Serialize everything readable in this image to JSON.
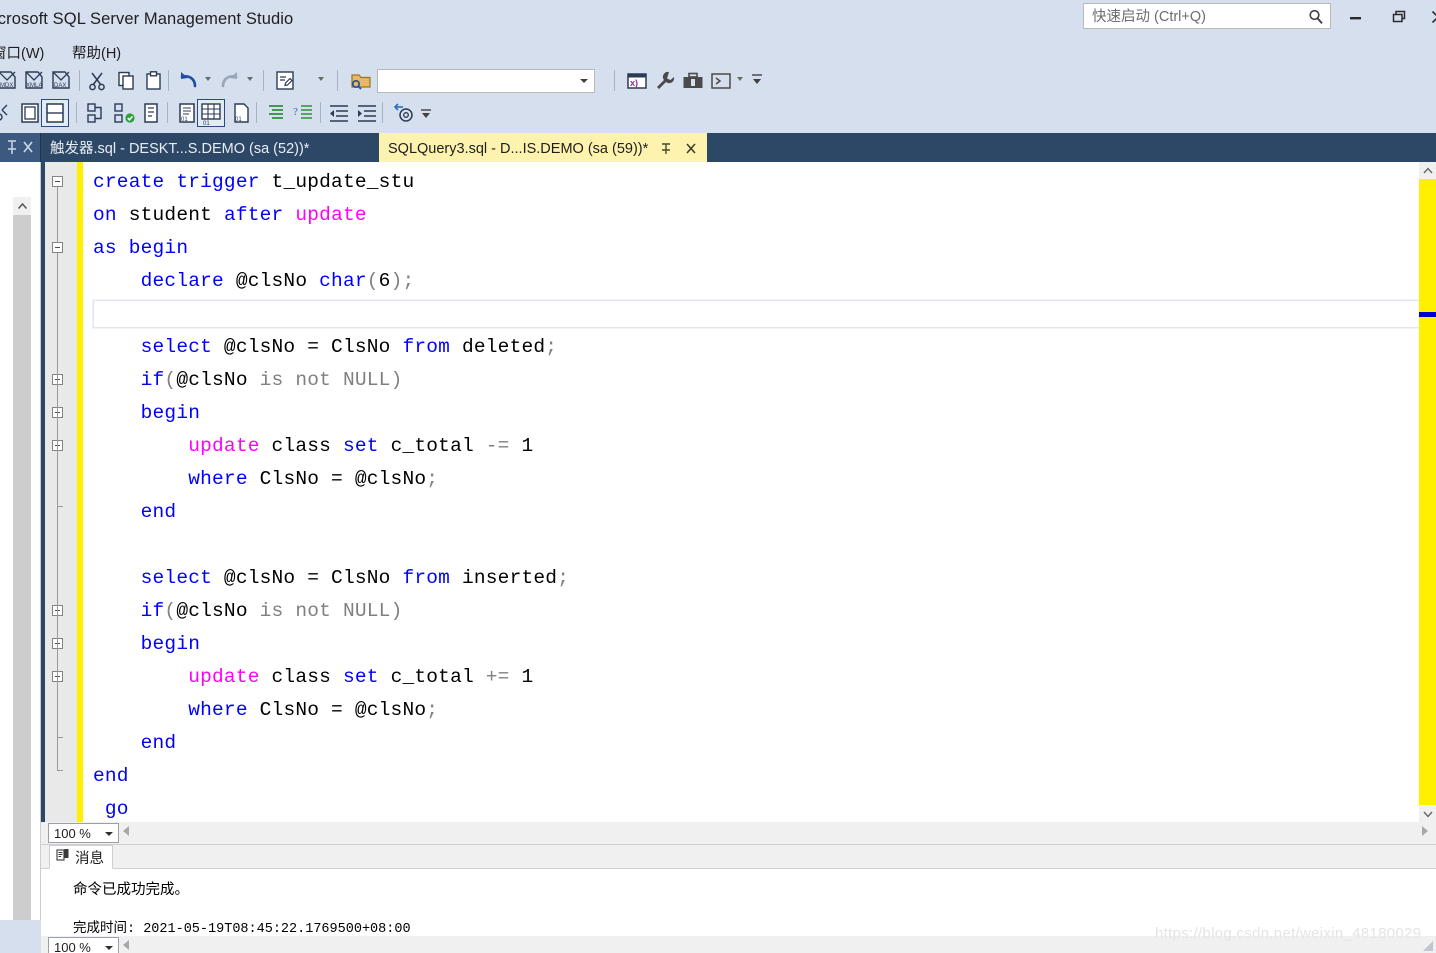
{
  "window": {
    "title": "icrosoft SQL Server Management Studio",
    "controls": {
      "minimize": "minimize-icon",
      "maximize": "maximize-icon",
      "close": "close-icon"
    }
  },
  "quick_launch": {
    "placeholder": "快速启动 (Ctrl+Q)",
    "value": "",
    "icon": "search-icon"
  },
  "menubar": {
    "items": [
      {
        "label": "窗口(W)",
        "name": "menu-window"
      },
      {
        "label": "帮助(H)",
        "name": "menu-help"
      }
    ]
  },
  "toolbar": {
    "combo_value": "",
    "overflow_label": "▾"
  },
  "tabs": [
    {
      "label": "触发器.sql - DESKT...S.DEMO (sa (52))*",
      "active": false,
      "name": "tab-trigger-sql"
    },
    {
      "label": "SQLQuery3.sql - D...IS.DEMO (sa (59))*",
      "active": true,
      "name": "tab-sqlquery3-sql"
    }
  ],
  "editor": {
    "zoom_label": "100 %",
    "lines": [
      [
        {
          "t": "create ",
          "c": "kw"
        },
        {
          "t": "trigger ",
          "c": "kw"
        },
        {
          "t": "t_update_stu",
          "c": ""
        }
      ],
      [
        {
          "t": "on ",
          "c": "kw"
        },
        {
          "t": "student ",
          "c": ""
        },
        {
          "t": "after ",
          "c": "kw"
        },
        {
          "t": "update",
          "c": "mag"
        }
      ],
      [
        {
          "t": "as ",
          "c": "kw"
        },
        {
          "t": "begin",
          "c": "kw"
        }
      ],
      [
        {
          "t": "    declare ",
          "c": "kw"
        },
        {
          "t": "@clsNo ",
          "c": ""
        },
        {
          "t": "char",
          "c": "kw"
        },
        {
          "t": "(",
          "c": "pun"
        },
        {
          "t": "6",
          "c": "num"
        },
        {
          "t": ")",
          "c": "pun"
        },
        {
          "t": ";",
          "c": "pun"
        }
      ],
      [
        {
          "t": "",
          "c": ""
        }
      ],
      [
        {
          "t": "    select ",
          "c": "kw"
        },
        {
          "t": "@clsNo = ClsNo ",
          "c": ""
        },
        {
          "t": "from ",
          "c": "kw"
        },
        {
          "t": "deleted",
          "c": ""
        },
        {
          "t": ";",
          "c": "pun"
        }
      ],
      [
        {
          "t": "    if",
          "c": "kw"
        },
        {
          "t": "(",
          "c": "pun"
        },
        {
          "t": "@clsNo ",
          "c": ""
        },
        {
          "t": "is not NULL",
          "c": "gry"
        },
        {
          "t": ")",
          "c": "pun"
        }
      ],
      [
        {
          "t": "    begin",
          "c": "kw"
        }
      ],
      [
        {
          "t": "        update ",
          "c": "mag"
        },
        {
          "t": "class ",
          "c": ""
        },
        {
          "t": "set ",
          "c": "kw"
        },
        {
          "t": "c_total ",
          "c": ""
        },
        {
          "t": "-= ",
          "c": "pun"
        },
        {
          "t": "1",
          "c": "num"
        }
      ],
      [
        {
          "t": "        where ",
          "c": "kw"
        },
        {
          "t": "ClsNo = @clsNo",
          "c": ""
        },
        {
          "t": ";",
          "c": "pun"
        }
      ],
      [
        {
          "t": "    end",
          "c": "kw"
        }
      ],
      [
        {
          "t": "",
          "c": ""
        }
      ],
      [
        {
          "t": "    select ",
          "c": "kw"
        },
        {
          "t": "@clsNo = ClsNo ",
          "c": ""
        },
        {
          "t": "from ",
          "c": "kw"
        },
        {
          "t": "inserted",
          "c": ""
        },
        {
          "t": ";",
          "c": "pun"
        }
      ],
      [
        {
          "t": "    if",
          "c": "kw"
        },
        {
          "t": "(",
          "c": "pun"
        },
        {
          "t": "@clsNo ",
          "c": ""
        },
        {
          "t": "is not NULL",
          "c": "gry"
        },
        {
          "t": ")",
          "c": "pun"
        }
      ],
      [
        {
          "t": "    begin",
          "c": "kw"
        }
      ],
      [
        {
          "t": "        update ",
          "c": "mag"
        },
        {
          "t": "class ",
          "c": ""
        },
        {
          "t": "set ",
          "c": "kw"
        },
        {
          "t": "c_total ",
          "c": ""
        },
        {
          "t": "+= ",
          "c": "pun"
        },
        {
          "t": "1",
          "c": "num"
        }
      ],
      [
        {
          "t": "        where ",
          "c": "kw"
        },
        {
          "t": "ClsNo = @clsNo",
          "c": ""
        },
        {
          "t": ";",
          "c": "pun"
        }
      ],
      [
        {
          "t": "    end",
          "c": "kw"
        }
      ],
      [
        {
          "t": "end",
          "c": "kw"
        }
      ],
      [
        {
          "t": " go",
          "c": "kw"
        }
      ]
    ],
    "current_line_index": 4,
    "fold_rows": [
      0,
      2,
      6,
      7,
      8,
      13,
      14,
      15
    ],
    "colors": {
      "keyword": "#0000ff",
      "magenta": "#ff00ff",
      "gray": "#808080",
      "text": "#000000",
      "change_bar": "#fff000",
      "tab_active_bg": "#fdf3ae",
      "doc_bar_bg": "#2d4866"
    }
  },
  "results": {
    "tab_label": "消息",
    "tab_icon": "messages-icon",
    "zoom_label": "100 %",
    "lines": [
      {
        "text": "命令已成功完成。",
        "mono": false
      },
      {
        "text": "",
        "mono": false
      },
      {
        "text": "完成时间: 2021-05-19T08:45:22.1769500+08:00",
        "mono": true
      }
    ]
  },
  "watermark": "https://blog.csdn.net/weixin_48180029"
}
